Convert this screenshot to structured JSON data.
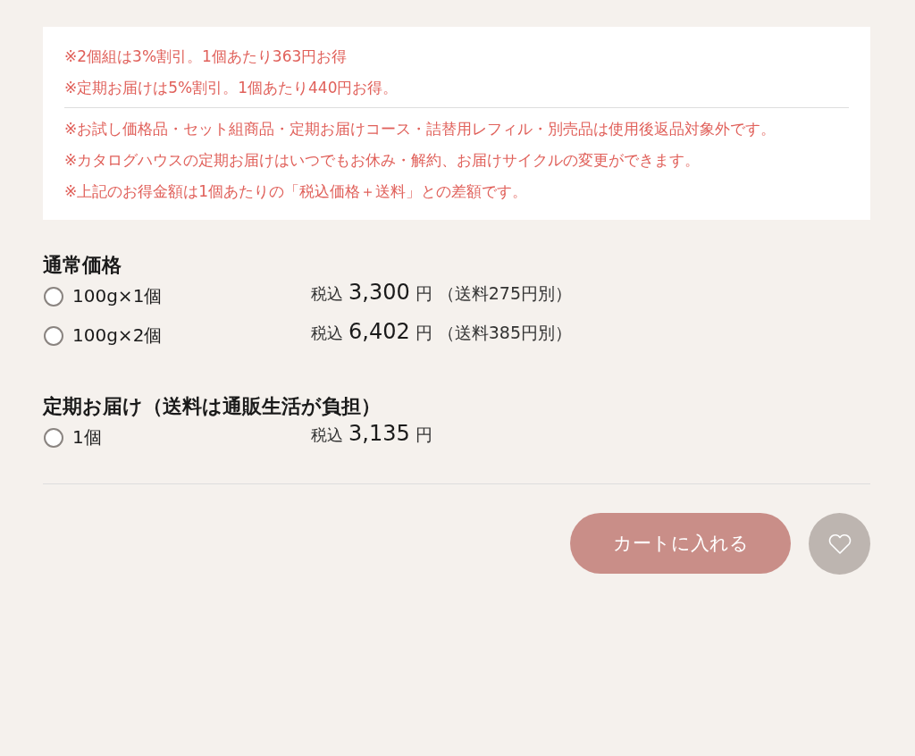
{
  "notes": {
    "discounts": [
      "※2個組は3%割引。1個あたり363円お得",
      "※定期お届けは5%割引。1個あたり440円お得。"
    ],
    "conditions": [
      "※お試し価格品・セット組商品・定期お届けコース・詰替用レフィル・別売品は使用後返品対象外です。",
      "※カタログハウスの定期お届けはいつでもお休み・解約、お届けサイクルの変更ができます。",
      "※上記のお得金額は1個あたりの「税込価格＋送料」との差額です。"
    ]
  },
  "sections": [
    {
      "heading": "通常価格",
      "options": [
        {
          "label": "100g×1個",
          "selected": false,
          "tax_label": "税込",
          "price": "3,300",
          "unit": "円",
          "shipping": "（送料275円別）"
        },
        {
          "label": "100g×2個",
          "selected": false,
          "tax_label": "税込",
          "price": "6,402",
          "unit": "円",
          "shipping": "（送料385円別）"
        }
      ]
    },
    {
      "heading": "定期お届け（送料は通販生活が負担）",
      "options": [
        {
          "label": "1個",
          "selected": false,
          "tax_label": "税込",
          "price": "3,135",
          "unit": "円"
        }
      ]
    }
  ],
  "cart_button": "カートに入れる"
}
